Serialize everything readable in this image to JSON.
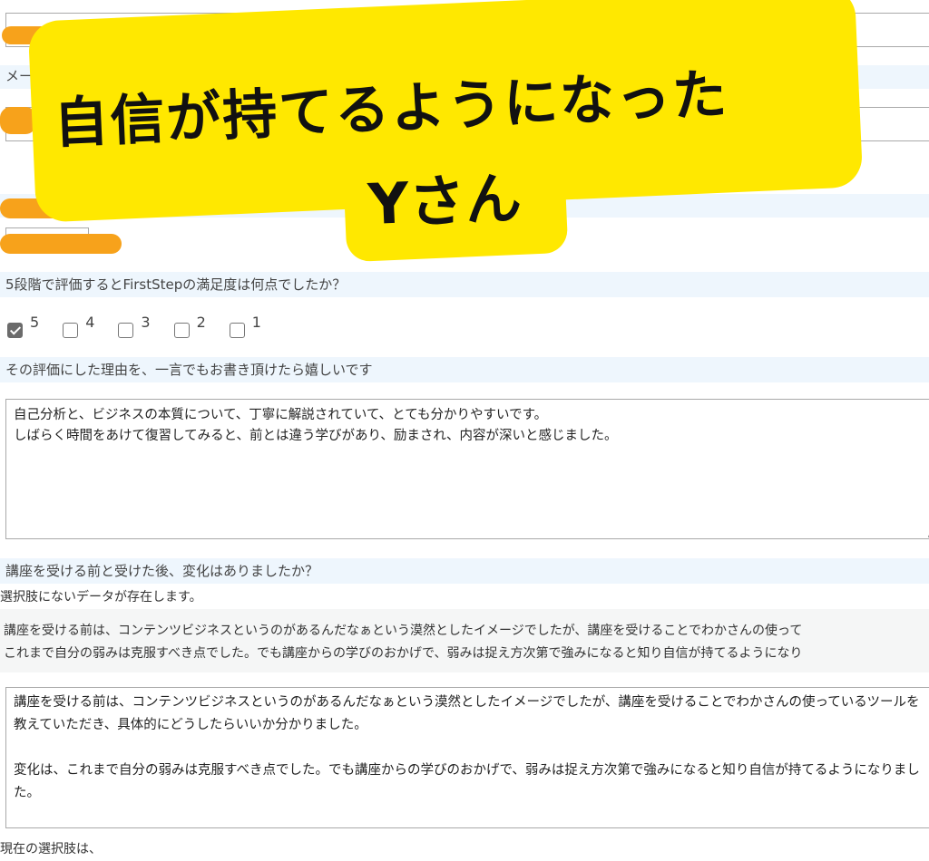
{
  "form": {
    "email_label": "メールアドレス",
    "rating_question": "5段階で評価するとFirstStepの満足度は何点でしたか？",
    "rating_options": [
      {
        "value": "5",
        "checked": true
      },
      {
        "value": "4",
        "checked": false
      },
      {
        "value": "3",
        "checked": false
      },
      {
        "value": "2",
        "checked": false
      },
      {
        "value": "1",
        "checked": false
      }
    ],
    "reason_label": "その評価にした理由を、一言でもお書き頂けたら嬉しいです",
    "reason_text": "自己分析と、ビジネスの本質について、丁寧に解説されていて、とても分かりやすいです。\nしばらく時間をあけて復習してみると、前とは違う学びがあり、励まされ、内容が深いと感じました。",
    "change_label": "講座を受ける前と受けた後、変化はありましたか？",
    "missing_choice_notice": "選択肢にないデータが存在します。",
    "existing_data_line1": "講座を受ける前は、コンテンツビジネスというのがあるんだなぁという漠然としたイメージでしたが、講座を受けることでわかさんの使って",
    "existing_data_line2": "これまで自分の弱みは克服すべき点でした。でも講座からの学びのおかげで、弱みは捉え方次第で強みになると知り自信が持てるようになり",
    "change_text": "講座を受ける前は、コンテンツビジネスというのがあるんだなぁという漠然としたイメージでしたが、講座を受けることでわかさんの使っているツールを教えていただき、具体的にどうしたらいいか分かりました。\n\n変化は、これまで自分の弱みは克服すべき点でした。でも講座からの学びのおかげで、弱みは捉え方次第で強みになると知り自信が持てるようになりました。",
    "current_choice_label": "現在の選択肢は、"
  },
  "overlay": {
    "line1": "自信が持てるようになった",
    "line2": "Yさん"
  },
  "colors": {
    "label_bg": "#eef6fd",
    "overlay_yellow": "#ffe800",
    "redaction": "#f7a21b"
  }
}
